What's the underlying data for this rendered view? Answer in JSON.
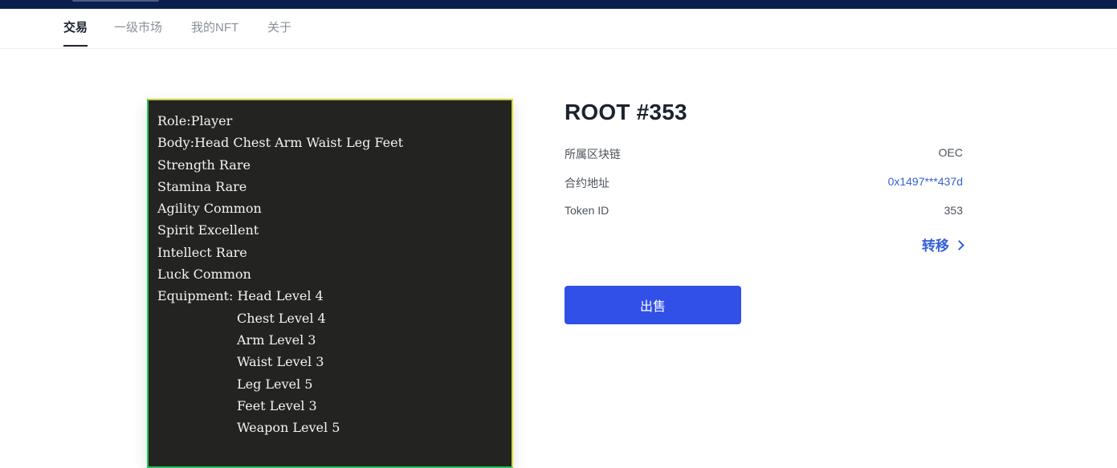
{
  "nav": {
    "tabs": [
      {
        "label": "交易",
        "active": true
      },
      {
        "label": "一级市场",
        "active": false
      },
      {
        "label": "我的NFT",
        "active": false
      },
      {
        "label": "关于",
        "active": false
      }
    ]
  },
  "nft_image": {
    "lines": [
      "Role:Player",
      "Body:Head Chest Arm Waist Leg Feet",
      "Strength Rare",
      "Stamina Rare",
      "Agility Common",
      "Spirit Excellent",
      "Intellect Rare",
      "Luck Common",
      "Equipment: Head Level 4",
      "Chest Level 4",
      "Arm Level 3",
      "Waist Level 3",
      "Leg Level 5",
      "Feet Level 3",
      "Weapon Level 5"
    ]
  },
  "detail": {
    "title": "ROOT #353",
    "chain_label": "所属区块链",
    "chain_value": "OEC",
    "contract_label": "合约地址",
    "contract_value": "0x1497***437d",
    "token_label": "Token ID",
    "token_value": "353",
    "transfer_label": "转移",
    "sell_label": "出售"
  },
  "colors": {
    "header_bg": "#0b1f4f",
    "accent": "#3150e8",
    "link": "#3560d8",
    "card_bg": "#232422"
  }
}
